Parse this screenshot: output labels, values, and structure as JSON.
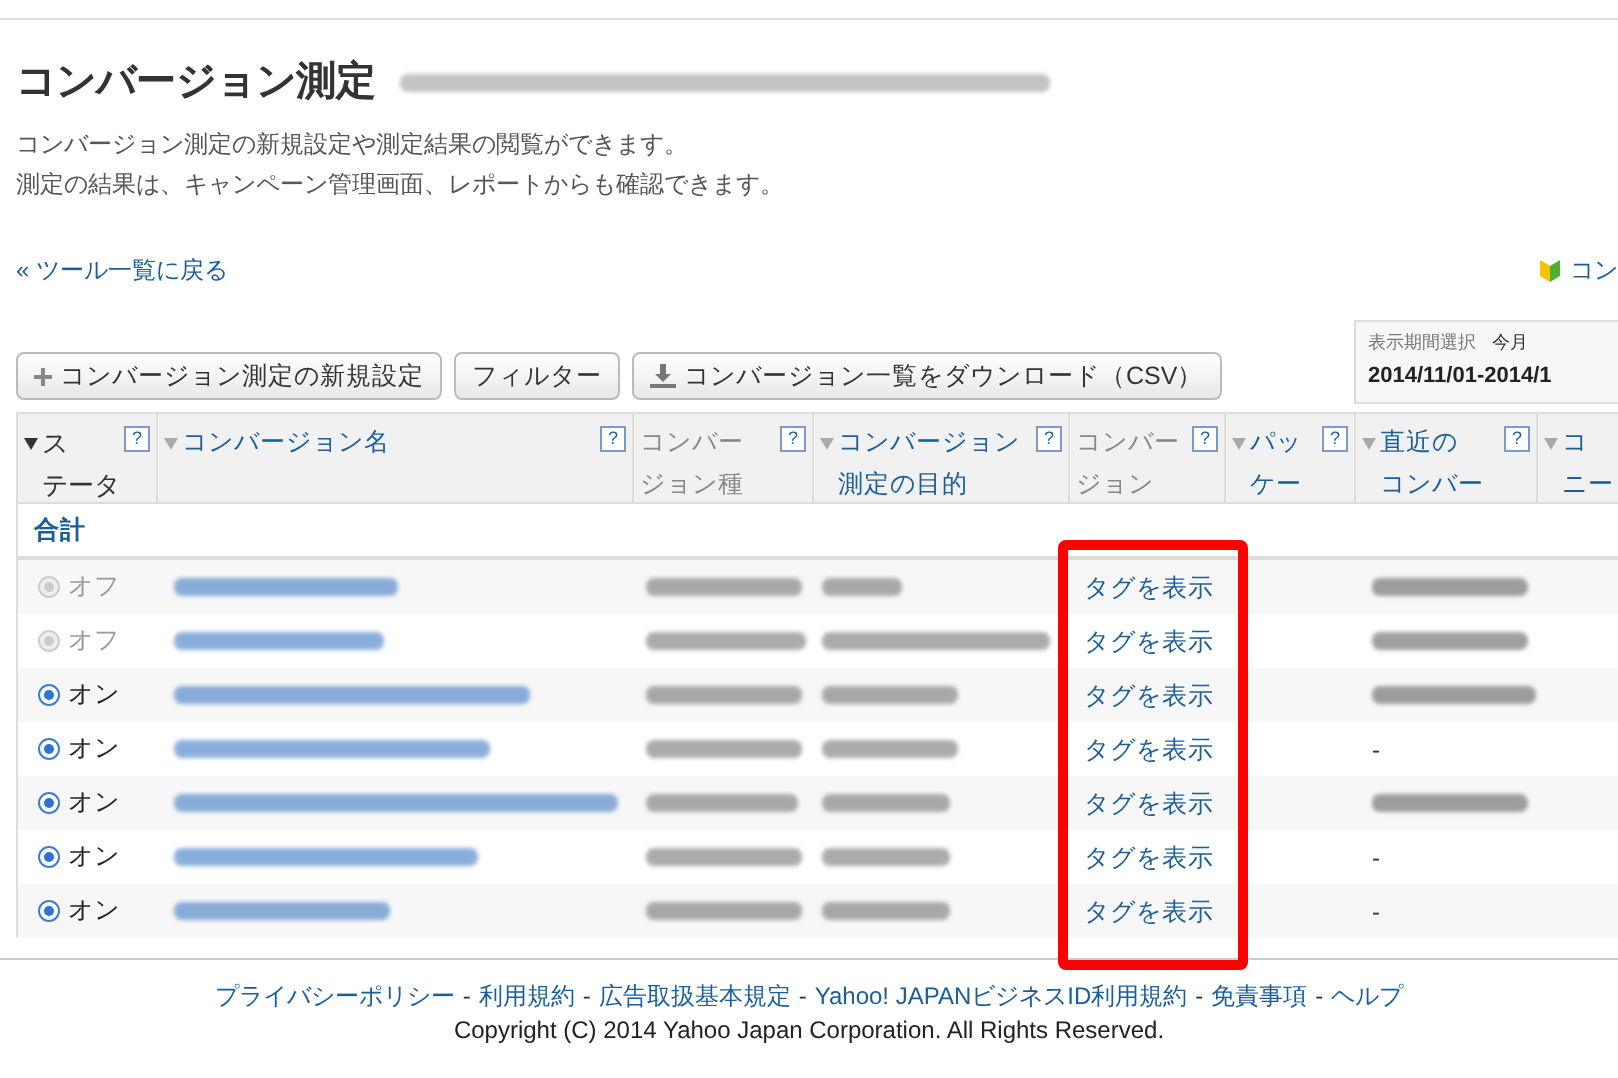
{
  "page_title": "コンバージョン測定",
  "description": [
    "コンバージョン測定の新規設定や測定結果の閲覧ができます。",
    "測定の結果は、キャンペーン管理画面、レポートからも確認できます。"
  ],
  "back_link": "« ツール一覧に戻る",
  "help_link": "コン",
  "toolbar": [
    {
      "label": "コンバージョン測定の新規設定",
      "kind": "add"
    },
    {
      "label": "フィルター",
      "kind": "plain"
    },
    {
      "label": "コンバージョン一覧をダウンロード（CSV）",
      "kind": "download"
    }
  ],
  "period": {
    "label": "表示期間選択",
    "value": "今月",
    "range": "2014/11/01-2014/1"
  },
  "table": {
    "columns": [
      {
        "label": [
          "ス",
          "テータ"
        ],
        "kind": "sorted",
        "help": "?"
      },
      {
        "label": [
          "コンバージョン名"
        ],
        "kind": "sortable",
        "help": "?"
      },
      {
        "label": [
          "コンバー",
          "ジョン種"
        ],
        "kind": "plain",
        "help": "?"
      },
      {
        "label": [
          "コンバージョン",
          "測定の目的"
        ],
        "kind": "sortable",
        "help": "?"
      },
      {
        "label": [
          "コンバー",
          "ジョン"
        ],
        "kind": "plain",
        "help": "?"
      },
      {
        "label": [
          "パッ",
          "ケー"
        ],
        "kind": "sortable",
        "help": "?"
      },
      {
        "label": [
          "直近の",
          "コンバー"
        ],
        "kind": "sortable",
        "help": "?"
      },
      {
        "label": [
          "コ",
          "ニー"
        ],
        "kind": "sortable"
      }
    ],
    "total_label": "合計",
    "rows": [
      {
        "status": "オフ",
        "on": false,
        "tag_link": "タグを表示"
      },
      {
        "status": "オフ",
        "on": false,
        "tag_link": "タグを表示"
      },
      {
        "status": "オン",
        "on": true,
        "tag_link": "タグを表示"
      },
      {
        "status": "オン",
        "on": true,
        "tag_link": "タグを表示",
        "recent": "-"
      },
      {
        "status": "オン",
        "on": true,
        "tag_link": "タグを表示"
      },
      {
        "status": "オン",
        "on": true,
        "tag_link": "タグを表示",
        "recent": "-"
      },
      {
        "status": "オン",
        "on": true,
        "tag_link": "タグを表示",
        "recent": "-"
      }
    ]
  },
  "footer": {
    "links": [
      "プライバシーポリシー",
      "利用規約",
      "広告取扱基本規定",
      "Yahoo! JAPANビジネスID利用規約",
      "免責事項",
      "ヘルプ"
    ],
    "separator": "-",
    "copyright": "Copyright (C) 2014 Yahoo Japan Corporation. All Rights Reserved."
  }
}
